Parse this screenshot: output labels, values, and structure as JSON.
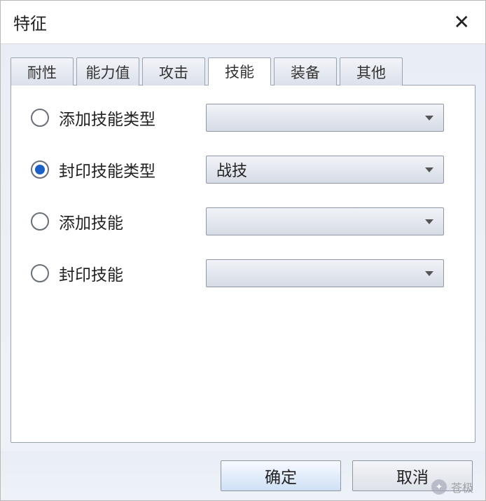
{
  "dialog": {
    "title": "特征"
  },
  "tabs": [
    {
      "label": "耐性",
      "active": false
    },
    {
      "label": "能力值",
      "active": false
    },
    {
      "label": "攻击",
      "active": false
    },
    {
      "label": "技能",
      "active": true
    },
    {
      "label": "装备",
      "active": false
    },
    {
      "label": "其他",
      "active": false
    }
  ],
  "options": [
    {
      "label": "添加技能类型",
      "selected": false,
      "value": ""
    },
    {
      "label": "封印技能类型",
      "selected": true,
      "value": "战技"
    },
    {
      "label": "添加技能",
      "selected": false,
      "value": ""
    },
    {
      "label": "封印技能",
      "selected": false,
      "value": ""
    }
  ],
  "buttons": {
    "ok": "确定",
    "cancel": "取消"
  },
  "watermark": "苍极"
}
